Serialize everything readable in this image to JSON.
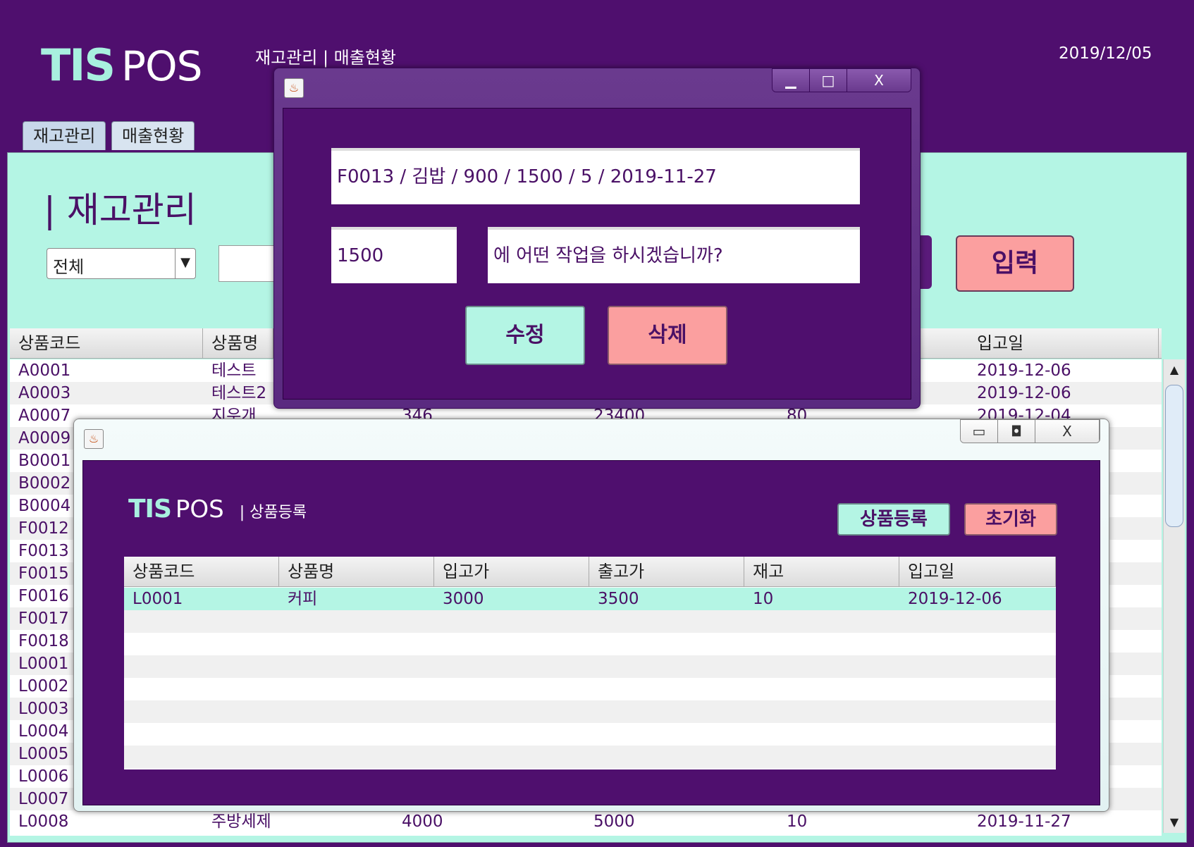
{
  "main": {
    "logo_tis": "TIS",
    "logo_pos": "POS",
    "nav": "재고관리 | 매출현황",
    "date": "2019/12/05",
    "tabs": [
      "재고관리",
      "매출현황"
    ],
    "page_title": "| 재고관리",
    "filter_value": "전체",
    "input_button": "입력",
    "columns": [
      "상품코드",
      "상품명",
      "입고일"
    ],
    "rows": [
      {
        "code": "A0001",
        "name": "테스트",
        "col3": "",
        "col4": "",
        "col5": "",
        "date": "2019-12-06"
      },
      {
        "code": "A0003",
        "name": "테스트2",
        "col3": "",
        "col4": "",
        "col5": "",
        "date": "2019-12-06"
      },
      {
        "code": "A0007",
        "name": "지우개",
        "col3": "346",
        "col4": "23400",
        "col5": "80",
        "date": "2019-12-04"
      },
      {
        "code": "A0009",
        "name": "",
        "col3": "",
        "col4": "",
        "col5": "",
        "date": ""
      },
      {
        "code": "B0001",
        "name": "",
        "col3": "",
        "col4": "",
        "col5": "",
        "date": ""
      },
      {
        "code": "B0002",
        "name": "",
        "col3": "",
        "col4": "",
        "col5": "",
        "date": ""
      },
      {
        "code": "B0004",
        "name": "",
        "col3": "",
        "col4": "",
        "col5": "",
        "date": ""
      },
      {
        "code": "F0012",
        "name": "",
        "col3": "",
        "col4": "",
        "col5": "",
        "date": ""
      },
      {
        "code": "F0013",
        "name": "",
        "col3": "",
        "col4": "",
        "col5": "",
        "date": ""
      },
      {
        "code": "F0015",
        "name": "",
        "col3": "",
        "col4": "",
        "col5": "",
        "date": ""
      },
      {
        "code": "F0016",
        "name": "",
        "col3": "",
        "col4": "",
        "col5": "",
        "date": ""
      },
      {
        "code": "F0017",
        "name": "",
        "col3": "",
        "col4": "",
        "col5": "",
        "date": ""
      },
      {
        "code": "F0018",
        "name": "",
        "col3": "",
        "col4": "",
        "col5": "",
        "date": ""
      },
      {
        "code": "L0001",
        "name": "",
        "col3": "",
        "col4": "",
        "col5": "",
        "date": ""
      },
      {
        "code": "L0002",
        "name": "",
        "col3": "",
        "col4": "",
        "col5": "",
        "date": ""
      },
      {
        "code": "L0003",
        "name": "",
        "col3": "",
        "col4": "",
        "col5": "",
        "date": ""
      },
      {
        "code": "L0004",
        "name": "",
        "col3": "",
        "col4": "",
        "col5": "",
        "date": ""
      },
      {
        "code": "L0005",
        "name": "",
        "col3": "",
        "col4": "",
        "col5": "",
        "date": ""
      },
      {
        "code": "L0006",
        "name": "",
        "col3": "",
        "col4": "",
        "col5": "",
        "date": ""
      },
      {
        "code": "L0007",
        "name": "",
        "col3": "",
        "col4": "",
        "col5": "",
        "date": ""
      },
      {
        "code": "L0008",
        "name": "주방세제",
        "col3": "4000",
        "col4": "5000",
        "col5": "10",
        "date": "2019-11-27"
      }
    ]
  },
  "edit_dialog": {
    "window_controls": [
      "▁",
      "□",
      "X"
    ],
    "record": "F0013 / 김밥 / 900 / 1500 / 5 / 2019-11-27",
    "price_value": "1500",
    "question": "에 어떤 작업을 하시겠습니까?",
    "modify_button": "수정",
    "delete_button": "삭제"
  },
  "register_dialog": {
    "window_controls": [
      "▭",
      "◘",
      "X"
    ],
    "logo_tis": "TIS",
    "logo_pos": "POS",
    "subtitle": "| 상품등록",
    "register_button": "상품등록",
    "reset_button": "초기화",
    "columns": [
      "상품코드",
      "상품명",
      "입고가",
      "출고가",
      "재고",
      "입고일"
    ],
    "rows": [
      {
        "code": "L0001",
        "name": "커피",
        "in_price": "3000",
        "out_price": "3500",
        "stock": "10",
        "date": "2019-12-06"
      }
    ]
  },
  "colors": {
    "background": "#4f0f6e",
    "mint": "#b4f5e4",
    "pink": "#fb9f9f",
    "text_purple": "#4a1066"
  }
}
